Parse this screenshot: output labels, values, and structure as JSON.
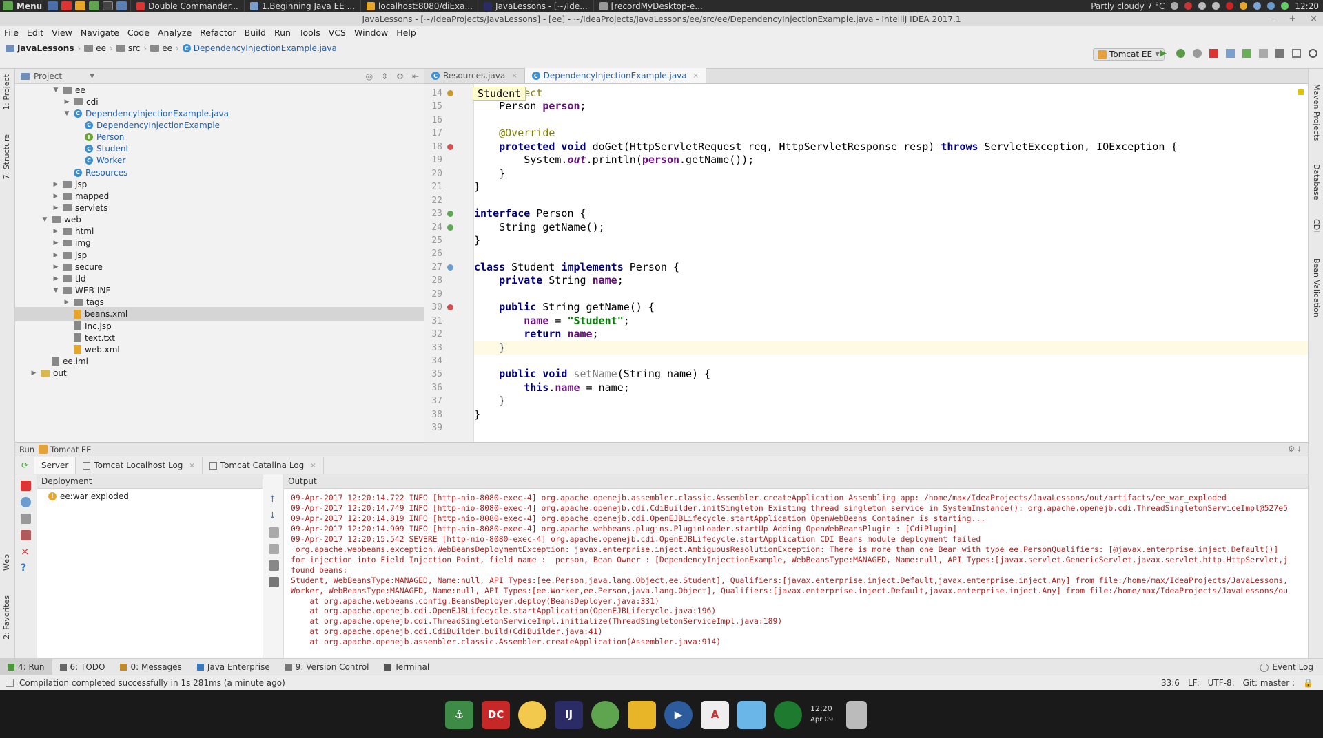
{
  "taskbar": {
    "menu_label": "Menu",
    "tasks": [
      "Double Commander...",
      "1.Beginning Java EE ...",
      "localhost:8080/diExa...",
      "JavaLessons - [~/Ide...",
      "[recordMyDesktop-e..."
    ],
    "weather": "Partly cloudy 7 °C",
    "clock": "12:20"
  },
  "window": {
    "title": "JavaLessons - [~/IdeaProjects/JavaLessons] - [ee] - ~/IdeaProjects/JavaLessons/ee/src/ee/DependencyInjectionExample.java - IntelliJ IDEA 2017.1"
  },
  "menubar": [
    "File",
    "Edit",
    "View",
    "Navigate",
    "Code",
    "Analyze",
    "Refactor",
    "Build",
    "Run",
    "Tools",
    "VCS",
    "Window",
    "Help"
  ],
  "breadcrumb": [
    "JavaLessons",
    "ee",
    "src",
    "ee",
    "DependencyInjectionExample.java"
  ],
  "run_config": "Tomcat EE",
  "left_tabs": [
    "1: Project",
    "7: Structure",
    "Web",
    "2: Favorites"
  ],
  "right_tabs": [
    "Maven Projects",
    "Database",
    "CDI",
    "Bean Validation"
  ],
  "project_panel": {
    "title": "Project",
    "tree": [
      {
        "label": "ee",
        "depth": 3,
        "arrow": "▼",
        "icon": "folder",
        "selected": false
      },
      {
        "label": "cdi",
        "depth": 4,
        "arrow": "▶",
        "icon": "folder",
        "selected": false
      },
      {
        "label": "DependencyInjectionExample.java",
        "depth": 4,
        "arrow": "▼",
        "icon": "class",
        "selected": false
      },
      {
        "label": "DependencyInjectionExample",
        "depth": 5,
        "arrow": "",
        "icon": "class",
        "selected": false
      },
      {
        "label": "Person",
        "depth": 5,
        "arrow": "",
        "icon": "interface",
        "selected": false
      },
      {
        "label": "Student",
        "depth": 5,
        "arrow": "",
        "icon": "class",
        "selected": false
      },
      {
        "label": "Worker",
        "depth": 5,
        "arrow": "",
        "icon": "class",
        "selected": false
      },
      {
        "label": "Resources",
        "depth": 4,
        "arrow": "",
        "icon": "class",
        "selected": false
      },
      {
        "label": "jsp",
        "depth": 3,
        "arrow": "▶",
        "icon": "folder",
        "selected": false
      },
      {
        "label": "mapped",
        "depth": 3,
        "arrow": "▶",
        "icon": "folder",
        "selected": false
      },
      {
        "label": "servlets",
        "depth": 3,
        "arrow": "▶",
        "icon": "folder",
        "selected": false
      },
      {
        "label": "web",
        "depth": 2,
        "arrow": "▼",
        "icon": "folder",
        "selected": false
      },
      {
        "label": "html",
        "depth": 3,
        "arrow": "▶",
        "icon": "folder",
        "selected": false
      },
      {
        "label": "img",
        "depth": 3,
        "arrow": "▶",
        "icon": "folder",
        "selected": false
      },
      {
        "label": "jsp",
        "depth": 3,
        "arrow": "▶",
        "icon": "folder",
        "selected": false
      },
      {
        "label": "secure",
        "depth": 3,
        "arrow": "▶",
        "icon": "folder",
        "selected": false
      },
      {
        "label": "tld",
        "depth": 3,
        "arrow": "▶",
        "icon": "folder",
        "selected": false
      },
      {
        "label": "WEB-INF",
        "depth": 3,
        "arrow": "▼",
        "icon": "folder",
        "selected": false
      },
      {
        "label": "tags",
        "depth": 4,
        "arrow": "▶",
        "icon": "folder",
        "selected": false
      },
      {
        "label": "beans.xml",
        "depth": 4,
        "arrow": "",
        "icon": "xml",
        "selected": true
      },
      {
        "label": "Inc.jsp",
        "depth": 4,
        "arrow": "",
        "icon": "file",
        "selected": false
      },
      {
        "label": "text.txt",
        "depth": 4,
        "arrow": "",
        "icon": "file",
        "selected": false
      },
      {
        "label": "web.xml",
        "depth": 4,
        "arrow": "",
        "icon": "xml",
        "selected": false
      },
      {
        "label": "ee.iml",
        "depth": 2,
        "arrow": "",
        "icon": "file",
        "selected": false
      },
      {
        "label": "out",
        "depth": 1,
        "arrow": "▶",
        "icon": "folder-yellow",
        "selected": false
      }
    ]
  },
  "editor": {
    "tabs": [
      {
        "label": "Resources.java",
        "active": false
      },
      {
        "label": "DependencyInjectionExample.java",
        "active": true
      }
    ],
    "breadcrumb_hint": "Student",
    "current_line": 33,
    "lines": [
      {
        "n": 14,
        "html": "    <span class=\"an\">@Inject</span>"
      },
      {
        "n": 15,
        "html": "    Person <span class=\"fld\">person</span>;"
      },
      {
        "n": 16,
        "html": ""
      },
      {
        "n": 17,
        "html": "    <span class=\"an\">@Override</span>"
      },
      {
        "n": 18,
        "html": "    <span class=\"kw\">protected void</span> doGet(HttpServletRequest req, HttpServletResponse resp) <span class=\"kw\">throws</span> ServletException, IOException {"
      },
      {
        "n": 19,
        "html": "        System.<span class=\"fld it\">out</span>.println(<span class=\"fld\">person</span>.getName());"
      },
      {
        "n": 20,
        "html": "    }"
      },
      {
        "n": 21,
        "html": "}"
      },
      {
        "n": 22,
        "html": ""
      },
      {
        "n": 23,
        "html": "<span class=\"kw\">interface</span> Person {"
      },
      {
        "n": 24,
        "html": "    String getName();"
      },
      {
        "n": 25,
        "html": "}"
      },
      {
        "n": 26,
        "html": ""
      },
      {
        "n": 27,
        "html": "<span class=\"kw\">class</span> Student <span class=\"kw\">implements</span> Person {"
      },
      {
        "n": 28,
        "html": "    <span class=\"kw\">private</span> String <span class=\"fld\">name</span>;"
      },
      {
        "n": 29,
        "html": ""
      },
      {
        "n": 30,
        "html": "    <span class=\"kw\">public</span> String getName() {"
      },
      {
        "n": 31,
        "html": "        <span class=\"fld\">name</span> = <span class=\"str\">\"Student\"</span>;"
      },
      {
        "n": 32,
        "html": "        <span class=\"kw\">return</span> <span class=\"fld\">name</span>;"
      },
      {
        "n": 33,
        "html": "    }"
      },
      {
        "n": 34,
        "html": ""
      },
      {
        "n": 35,
        "html": "    <span class=\"kw\">public void</span> <span class=\"gr\">setName</span>(String name) {"
      },
      {
        "n": 36,
        "html": "        <span class=\"kw\">this</span>.<span class=\"fld\">name</span> = name;"
      },
      {
        "n": 37,
        "html": "    }"
      },
      {
        "n": 38,
        "html": "}"
      },
      {
        "n": 39,
        "html": ""
      }
    ]
  },
  "run_panel": {
    "header": "Run",
    "config_name": "Tomcat EE",
    "tabs": [
      "Server",
      "Tomcat Localhost Log",
      "Tomcat Catalina Log"
    ],
    "deployment_title": "Deployment",
    "deployment_item": "ee:war exploded",
    "output_title": "Output",
    "output_lines": [
      "09-Apr-2017 12:20:14.722 INFO [http-nio-8080-exec-4] org.apache.openejb.assembler.classic.Assembler.createApplication Assembling app: /home/max/IdeaProjects/JavaLessons/out/artifacts/ee_war_exploded",
      "09-Apr-2017 12:20:14.749 INFO [http-nio-8080-exec-4] org.apache.openejb.cdi.CdiBuilder.initSingleton Existing thread singleton service in SystemInstance(): org.apache.openejb.cdi.ThreadSingletonServiceImpl@527e5",
      "09-Apr-2017 12:20:14.819 INFO [http-nio-8080-exec-4] org.apache.openejb.cdi.OpenEJBLifecycle.startApplication OpenWebBeans Container is starting...",
      "09-Apr-2017 12:20:14.909 INFO [http-nio-8080-exec-4] org.apache.webbeans.plugins.PluginLoader.startUp Adding OpenWebBeansPlugin : [CdiPlugin]",
      "09-Apr-2017 12:20:15.542 SEVERE [http-nio-8080-exec-4] org.apache.openejb.cdi.OpenEJBLifecycle.startApplication CDI Beans module deployment failed",
      " org.apache.webbeans.exception.WebBeansDeploymentException: javax.enterprise.inject.AmbiguousResolutionException: There is more than one Bean with type ee.PersonQualifiers: [@javax.enterprise.inject.Default()]",
      "for injection into Field Injection Point, field name :  person, Bean Owner : [DependencyInjectionExample, WebBeansType:MANAGED, Name:null, API Types:[javax.servlet.GenericServlet,javax.servlet.http.HttpServlet,j",
      "found beans:",
      "Student, WebBeansType:MANAGED, Name:null, API Types:[ee.Person,java.lang.Object,ee.Student], Qualifiers:[javax.enterprise.inject.Default,javax.enterprise.inject.Any] from file:/home/max/IdeaProjects/JavaLessons,",
      "Worker, WebBeansType:MANAGED, Name:null, API Types:[ee.Worker,ee.Person,java.lang.Object], Qualifiers:[javax.enterprise.inject.Default,javax.enterprise.inject.Any] from file:/home/max/IdeaProjects/JavaLessons/ou",
      "    at org.apache.webbeans.config.BeansDeployer.deploy(BeansDeployer.java:331)",
      "    at org.apache.openejb.cdi.OpenEJBLifecycle.startApplication(OpenEJBLifecycle.java:196)",
      "    at org.apache.openejb.cdi.ThreadSingletonServiceImpl.initialize(ThreadSingletonServiceImpl.java:189)",
      "    at org.apache.openejb.cdi.CdiBuilder.build(CdiBuilder.java:41)",
      "    at org.apache.openejb.assembler.classic.Assembler.createApplication(Assembler.java:914)"
    ]
  },
  "bottom_tabs": [
    "4: Run",
    "6: TODO",
    "0: Messages",
    "Java Enterprise",
    "9: Version Control",
    "Terminal"
  ],
  "event_log": "Event Log",
  "status": {
    "message": "Compilation completed successfully in 1s 281ms (a minute ago)",
    "position": "33:6",
    "line_sep": "LF:",
    "encoding": "UTF-8:",
    "git": "Git: master :"
  },
  "dock": {
    "clock_time": "12:20",
    "clock_date": "Apr 09"
  },
  "colors": {
    "accent": "#2060b0",
    "error_text": "#b22222",
    "selection": "#d5d5d5"
  }
}
